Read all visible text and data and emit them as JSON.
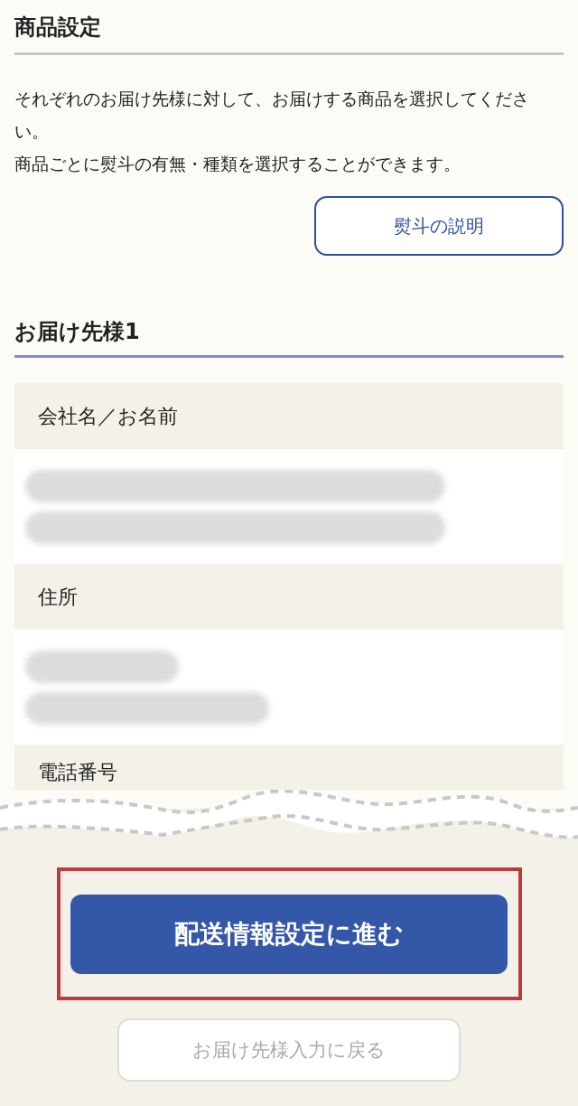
{
  "section_title": "商品設定",
  "intro": [
    "それぞれのお届け先様に対して、お届けする商品を選択してください。",
    "商品ごとに熨斗の有無・種類を選択することができます。"
  ],
  "info_button": "熨斗の説明",
  "recipient_title": "お届け先様1",
  "fields": [
    {
      "label": "会社名／お名前",
      "redacted": true
    },
    {
      "label": "住所",
      "redacted": true
    },
    {
      "label": "電話番号",
      "redacted": false
    }
  ],
  "primary_button": {
    "label": "配送情報設定に進む",
    "highlighted": true
  },
  "secondary_button": {
    "label": "お届け先様入力に戻る",
    "disabled": true
  }
}
